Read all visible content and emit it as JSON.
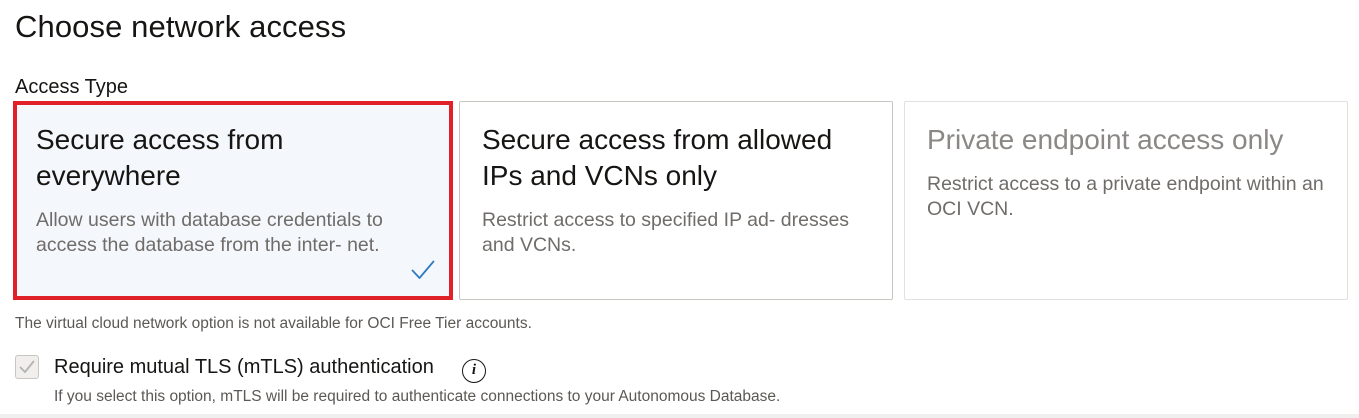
{
  "page": {
    "title": "Choose network access",
    "access_type_label": "Access Type"
  },
  "access_options": [
    {
      "title": "Secure access from everywhere",
      "description": "Allow users with database credentials to access the database from the inter- net.",
      "state": "selected"
    },
    {
      "title": "Secure access from allowed IPs and VCNs only",
      "description": "Restrict access to specified IP ad- dresses and VCNs.",
      "state": "enabled"
    },
    {
      "title": "Private endpoint access only",
      "description": "Restrict access to a private endpoint within an OCI VCN.",
      "state": "disabled"
    }
  ],
  "footnote": "The virtual cloud network option is not available for OCI Free Tier accounts.",
  "mtls": {
    "label": "Require mutual TLS (mTLS) authentication",
    "checked": true,
    "disabled": true,
    "info_icon": "i",
    "help": "If you select this option, mTLS will be required to authenticate connections to your Autonomous Database."
  },
  "colors": {
    "selection_border": "#e0212a",
    "check_accent": "#2f7bc1",
    "selected_bg": "#f4f7fb"
  }
}
